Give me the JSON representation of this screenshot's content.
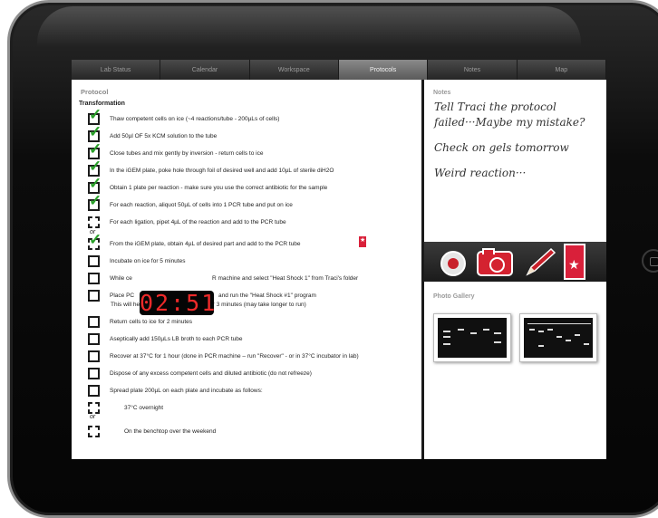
{
  "tabs": [
    {
      "label": "Lab Status",
      "active": false
    },
    {
      "label": "Calendar",
      "active": false
    },
    {
      "label": "Workspace",
      "active": false
    },
    {
      "label": "Protocols",
      "active": true
    },
    {
      "label": "Notes",
      "active": false
    },
    {
      "label": "Map",
      "active": false
    }
  ],
  "protocol": {
    "section_label": "Protocol",
    "title": "Transformation",
    "steps": [
      {
        "text": "Thaw competent cells on ice (~4 reactions/tube - 200µLs of cells)",
        "state": "checked"
      },
      {
        "text": "Add 50µl OF 5x KCM solution to the tube",
        "state": "checked"
      },
      {
        "text": "Close tubes and mix gently by inversion - return cells to ice",
        "state": "checked"
      },
      {
        "text": "In the iGEM plate, poke hole through foil of desired well and add 10µL of sterile diH2O",
        "state": "checked"
      },
      {
        "text": "Obtain 1 plate per reaction - make sure you use the correct antibiotic for the sample",
        "state": "checked"
      },
      {
        "text": "For each reaction, aliquot 50µL of cells into 1 PCR tube and put on ice",
        "state": "checked"
      },
      {
        "text": "For each ligation, pipet 4µL of the reaction and add to the PCR tube",
        "state": "option"
      },
      {
        "text": "From the iGEM plate, obtain 4µL of desired part and add to the PCR tube",
        "state": "option-checked"
      },
      {
        "text": "Incubate on ice for 5 minutes",
        "state": "empty"
      },
      {
        "text": "While cells incubate, turn on the PCR machine and select \"Heat Shock 1\" from Traci's folder",
        "display": "While ce",
        "display_tail": "R machine and select \"Heat Shock 1\" from Traci's folder",
        "state": "empty"
      },
      {
        "text": "Place PCR tubes in the machine and run the \"Heat Shock #1\" program",
        "display": "Place PC",
        "display_tail": "and run the \"Heat Shock #1\" program",
        "state": "empty"
      },
      {
        "text": "Return cells to ice for 2 minutes",
        "state": "empty"
      },
      {
        "text": "Aseptically add 150µLs LB broth to each PCR tube",
        "state": "empty"
      },
      {
        "text": "Recover at 37°C for 1 hour (done in PCR machine – run \"Recover\" - or in 37°C incubator in lab)",
        "state": "empty"
      },
      {
        "text": "Dispose of any excess competent cells and diluted antibiotic (do not refreeze)",
        "state": "empty"
      },
      {
        "text": "Spread plate 200µL on each plate and incubate as follows:",
        "state": "empty"
      }
    ],
    "subnote": "This will heat shock the cells at 42°C for 3 minutes (may take longer to run)",
    "incubate_options": [
      "37°C overnight",
      "On the benchtop over the weekend"
    ],
    "or_label": "or",
    "timer": "02:51"
  },
  "notes": {
    "label": "Notes",
    "lines": [
      "Tell Traci the protocol",
      "failed···Maybe my mistake?",
      "Check on gels tomorrow",
      "Weird reaction···"
    ]
  },
  "toolbar": {
    "icons": [
      "record-icon",
      "camera-icon",
      "pen-icon",
      "bookmark-icon"
    ]
  },
  "gallery": {
    "label": "Photo Gallery"
  },
  "colors": {
    "check": "#2aa12a",
    "timer_digits": "#ee2a2a",
    "accent_red": "#d42230"
  }
}
